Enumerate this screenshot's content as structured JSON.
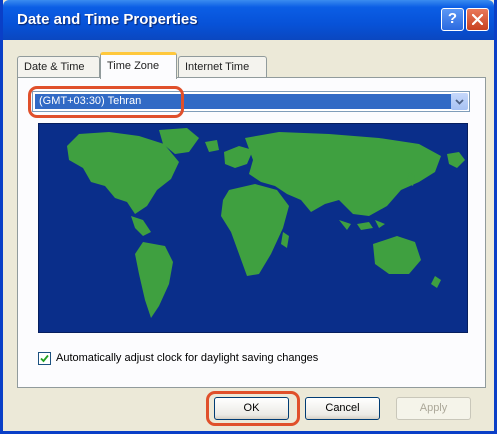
{
  "window": {
    "title": "Date and Time Properties"
  },
  "titlebar": {
    "help_glyph": "?",
    "close_icon": "close-icon"
  },
  "tabs": [
    {
      "label": "Date & Time",
      "active": false
    },
    {
      "label": "Time Zone",
      "active": true
    },
    {
      "label": "Internet Time",
      "active": false
    }
  ],
  "timezone": {
    "selected": "(GMT+03:30) Tehran"
  },
  "map": {
    "ocean_color": "#0A2E8A",
    "land_color": "#3FA040"
  },
  "daylight_checkbox": {
    "label": "Automatically adjust clock for daylight saving changes",
    "checked": true
  },
  "buttons": {
    "ok": "OK",
    "cancel": "Cancel",
    "apply": "Apply"
  },
  "highlight_color": "#E0502B"
}
